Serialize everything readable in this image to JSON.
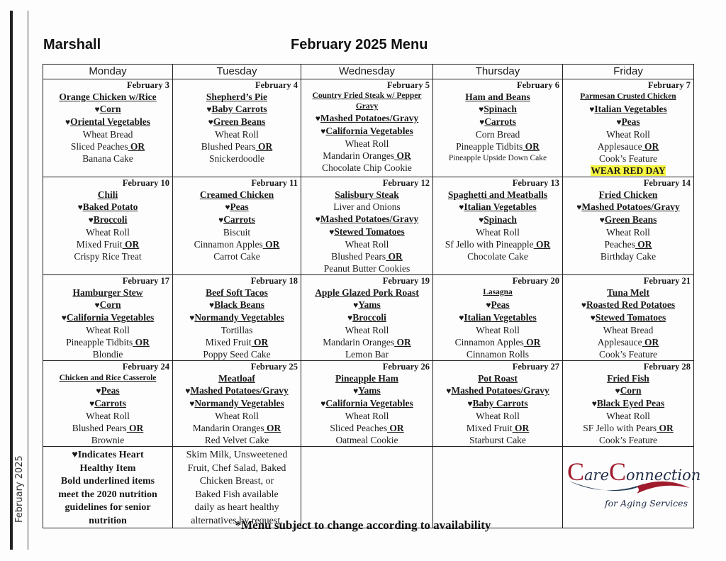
{
  "side_label": "February 2025",
  "site_name": "Marshall",
  "menu_title": "February 2025 Menu",
  "days": [
    "Monday",
    "Tuesday",
    "Wednesday",
    "Thursday",
    "Friday"
  ],
  "weeks": [
    [
      {
        "date": "February 3",
        "items": [
          {
            "text": "Orange Chicken w/Rice",
            "type": "main"
          },
          {
            "text": "Corn",
            "type": "heart"
          },
          {
            "text": "Oriental Vegetables",
            "type": "heart"
          },
          {
            "text": "Wheat Bread",
            "type": "plain"
          },
          {
            "text": "Sliced Peaches",
            "type": "or"
          },
          {
            "text": "Banana Cake",
            "type": "plain"
          }
        ]
      },
      {
        "date": "February 4",
        "items": [
          {
            "text": "Shepherd’s Pie",
            "type": "main"
          },
          {
            "text": "Baby Carrots",
            "type": "heart"
          },
          {
            "text": "Green Beans",
            "type": "heart"
          },
          {
            "text": "Wheat Roll",
            "type": "plain"
          },
          {
            "text": "Blushed Pears",
            "type": "or"
          },
          {
            "text": "Snickerdoodle",
            "type": "plain"
          }
        ]
      },
      {
        "date": "February 5",
        "items": [
          {
            "text": "Country Fried Steak w/ Pepper Gravy",
            "type": "main-small"
          },
          {
            "text": "Mashed Potatoes/Gravy",
            "type": "heart"
          },
          {
            "text": "California Vegetables",
            "type": "heart"
          },
          {
            "text": "Wheat Roll",
            "type": "plain"
          },
          {
            "text": "Mandarin Oranges",
            "type": "or"
          },
          {
            "text": "Chocolate Chip Cookie",
            "type": "plain"
          }
        ]
      },
      {
        "date": "February 6",
        "items": [
          {
            "text": "Ham and Beans",
            "type": "main"
          },
          {
            "text": "Spinach",
            "type": "heart"
          },
          {
            "text": "Carrots",
            "type": "heart"
          },
          {
            "text": "Corn Bread",
            "type": "plain"
          },
          {
            "text": "Pineapple Tidbits",
            "type": "or"
          },
          {
            "text": "Pineapple Upside Down Cake",
            "type": "plain-small"
          }
        ]
      },
      {
        "date": "February 7",
        "items": [
          {
            "text": "Parmesan Crusted Chicken",
            "type": "main-small"
          },
          {
            "text": "Italian Vegetables",
            "type": "heart"
          },
          {
            "text": "Peas",
            "type": "heart"
          },
          {
            "text": "Wheat Roll",
            "type": "plain"
          },
          {
            "text": "Applesauce",
            "type": "or"
          },
          {
            "text": "Cook’s Feature",
            "type": "plain"
          },
          {
            "text": "WEAR RED DAY",
            "type": "highlight"
          }
        ]
      }
    ],
    [
      {
        "date": "February 10",
        "items": [
          {
            "text": "Chili",
            "type": "main"
          },
          {
            "text": "Baked Potato",
            "type": "heart"
          },
          {
            "text": "Broccoli",
            "type": "heart"
          },
          {
            "text": "Wheat Roll",
            "type": "plain"
          },
          {
            "text": "Mixed Fruit",
            "type": "or"
          },
          {
            "text": "Crispy Rice Treat",
            "type": "plain"
          }
        ]
      },
      {
        "date": "February 11",
        "items": [
          {
            "text": "Creamed Chicken",
            "type": "main"
          },
          {
            "text": "Peas",
            "type": "heart"
          },
          {
            "text": "Carrots",
            "type": "heart"
          },
          {
            "text": "Biscuit",
            "type": "plain"
          },
          {
            "text": "Cinnamon Apples",
            "type": "or"
          },
          {
            "text": "Carrot Cake",
            "type": "plain"
          }
        ]
      },
      {
        "date": "February 12",
        "items": [
          {
            "text": "Salisbury Steak",
            "type": "main"
          },
          {
            "text": "Liver and Onions",
            "type": "plain"
          },
          {
            "text": "Mashed Potatoes/Gravy",
            "type": "heart"
          },
          {
            "text": "Stewed Tomatoes",
            "type": "heart"
          },
          {
            "text": "Wheat Roll",
            "type": "plain"
          },
          {
            "text": "Blushed Pears",
            "type": "or"
          },
          {
            "text": "Peanut Butter Cookies",
            "type": "plain"
          }
        ]
      },
      {
        "date": "February 13",
        "items": [
          {
            "text": "Spaghetti and Meatballs",
            "type": "main"
          },
          {
            "text": "Italian Vegetables",
            "type": "heart"
          },
          {
            "text": "Spinach",
            "type": "heart"
          },
          {
            "text": "Wheat Roll",
            "type": "plain"
          },
          {
            "text": "Sf Jello with Pineapple",
            "type": "or"
          },
          {
            "text": "Chocolate Cake",
            "type": "plain"
          }
        ]
      },
      {
        "date": "February 14",
        "items": [
          {
            "text": "Fried Chicken",
            "type": "main"
          },
          {
            "text": "Mashed Potatoes/Gravy",
            "type": "heart"
          },
          {
            "text": "Green Beans",
            "type": "heart"
          },
          {
            "text": "Wheat Roll",
            "type": "plain"
          },
          {
            "text": "Peaches",
            "type": "or"
          },
          {
            "text": "Birthday Cake",
            "type": "plain"
          }
        ]
      }
    ],
    [
      {
        "date": "February 17",
        "items": [
          {
            "text": "Hamburger Stew",
            "type": "main"
          },
          {
            "text": "Corn",
            "type": "heart"
          },
          {
            "text": "California Vegetables",
            "type": "heart"
          },
          {
            "text": "Wheat Roll",
            "type": "plain"
          },
          {
            "text": "Pineapple Tidbits",
            "type": "or"
          },
          {
            "text": "Blondie",
            "type": "plain"
          }
        ]
      },
      {
        "date": "February 18",
        "items": [
          {
            "text": "Beef Soft Tacos",
            "type": "main"
          },
          {
            "text": "Black Beans",
            "type": "heart"
          },
          {
            "text": "Normandy Vegetables",
            "type": "heart"
          },
          {
            "text": "Tortillas",
            "type": "plain"
          },
          {
            "text": "Mixed Fruit",
            "type": "or"
          },
          {
            "text": "Poppy Seed Cake",
            "type": "plain"
          }
        ]
      },
      {
        "date": "February 19",
        "items": [
          {
            "text": "Apple Glazed Pork Roast",
            "type": "main"
          },
          {
            "text": "Yams",
            "type": "heart"
          },
          {
            "text": "Broccoli",
            "type": "heart"
          },
          {
            "text": "Wheat Roll",
            "type": "plain"
          },
          {
            "text": "Mandarin Oranges",
            "type": "or"
          },
          {
            "text": "Lemon Bar",
            "type": "plain"
          }
        ]
      },
      {
        "date": "February 20",
        "items": [
          {
            "text": "Lasagna",
            "type": "main-small"
          },
          {
            "text": "Peas",
            "type": "heart"
          },
          {
            "text": "Italian Vegetables",
            "type": "heart"
          },
          {
            "text": "Wheat Roll",
            "type": "plain"
          },
          {
            "text": "Cinnamon Apples",
            "type": "or"
          },
          {
            "text": "Cinnamon Rolls",
            "type": "plain"
          }
        ]
      },
      {
        "date": "February 21",
        "items": [
          {
            "text": "Tuna Melt",
            "type": "main"
          },
          {
            "text": "Roasted Red Potatoes",
            "type": "heart"
          },
          {
            "text": "Stewed Tomatoes",
            "type": "heart"
          },
          {
            "text": "Wheat Bread",
            "type": "plain"
          },
          {
            "text": "Applesauce",
            "type": "or"
          },
          {
            "text": "Cook’s Feature",
            "type": "plain"
          }
        ]
      }
    ],
    [
      {
        "date": "February 24",
        "items": [
          {
            "text": "Chicken and Rice Casserole",
            "type": "main-small"
          },
          {
            "text": "Peas",
            "type": "heart"
          },
          {
            "text": "Carrots",
            "type": "heart"
          },
          {
            "text": "Wheat Roll",
            "type": "plain"
          },
          {
            "text": "Blushed Pears",
            "type": "or"
          },
          {
            "text": "Brownie",
            "type": "plain"
          }
        ]
      },
      {
        "date": "February 25",
        "items": [
          {
            "text": "Meatloaf",
            "type": "main"
          },
          {
            "text": "Mashed Potatoes/Gravy",
            "type": "heart"
          },
          {
            "text": "Normandy Vegetables",
            "type": "heart"
          },
          {
            "text": "Wheat Roll",
            "type": "plain"
          },
          {
            "text": "Mandarin Oranges",
            "type": "or"
          },
          {
            "text": "Red Velvet Cake",
            "type": "plain"
          }
        ]
      },
      {
        "date": "February 26",
        "items": [
          {
            "text": "Pineapple Ham",
            "type": "main"
          },
          {
            "text": "Yams",
            "type": "heart"
          },
          {
            "text": "California Vegetables",
            "type": "heart"
          },
          {
            "text": "Wheat Roll",
            "type": "plain"
          },
          {
            "text": "Sliced Peaches",
            "type": "or"
          },
          {
            "text": "Oatmeal Cookie",
            "type": "plain"
          }
        ]
      },
      {
        "date": "February 27",
        "items": [
          {
            "text": "Pot Roast",
            "type": "main"
          },
          {
            "text": "Mashed Potatoes/Gravy",
            "type": "heart"
          },
          {
            "text": "Baby Carrots",
            "type": "heart"
          },
          {
            "text": "Wheat Roll",
            "type": "plain"
          },
          {
            "text": "Mixed Fruit",
            "type": "or"
          },
          {
            "text": "Starburst Cake",
            "type": "plain"
          }
        ]
      },
      {
        "date": "February 28",
        "items": [
          {
            "text": "Fried Fish",
            "type": "main"
          },
          {
            "text": "Corn",
            "type": "heart"
          },
          {
            "text": "Black Eyed Peas",
            "type": "heart"
          },
          {
            "text": "Wheat Roll",
            "type": "plain"
          },
          {
            "text": "SF Jello with Pears",
            "type": "or"
          },
          {
            "text": "Cook’s Feature",
            "type": "plain"
          }
        ]
      }
    ]
  ],
  "or_label": "OR",
  "heart_symbol": "♥",
  "legend_lines": [
    "♥Indicates Heart",
    "Healthy Item",
    "Bold underlined items",
    "meet the 2020 nutrition",
    "guidelines for senior",
    "nutrition"
  ],
  "alternatives_lines": [
    "Skim Milk, Unsweetened",
    "Fruit, Chef Salad, Baked",
    "Chicken Breast, or",
    "Baked Fish available",
    "daily as heart healthy",
    "alternatives by request."
  ],
  "logo": {
    "care_cap": "C",
    "care_rest": "are",
    "connection_cap": "C",
    "connection_rest": "onnection",
    "tagline": "for Aging Services",
    "colors": {
      "red": "#a01c2c",
      "navy": "#1f3a55"
    }
  },
  "highlight_color": "#f5f542",
  "footer_note": "*Menu subject to change according to availability"
}
